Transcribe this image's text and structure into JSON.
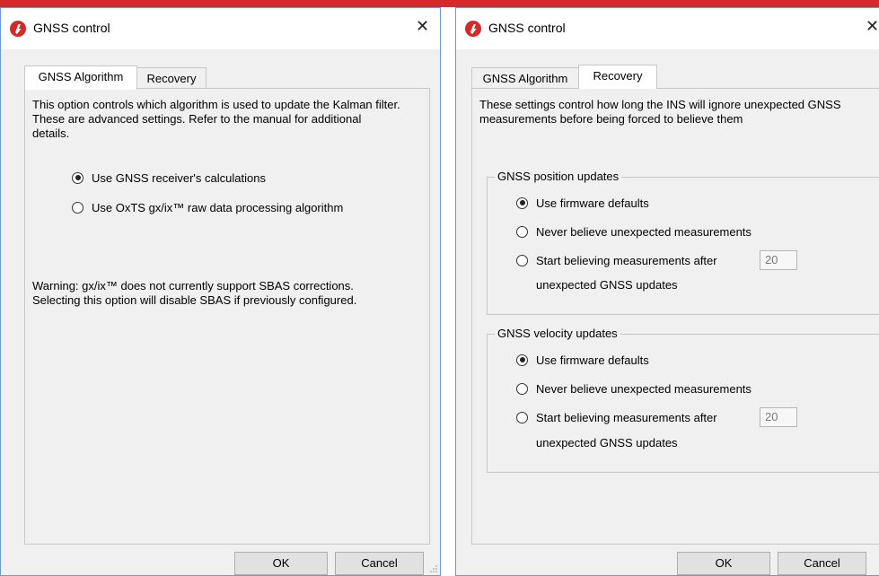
{
  "brand_color": "#d42a2a",
  "left_window": {
    "title": "GNSS control",
    "icon": "oxts-logo-icon",
    "close_label": "✕",
    "tabs": [
      {
        "label": "GNSS Algorithm",
        "active": true
      },
      {
        "label": "Recovery",
        "active": false
      }
    ],
    "description": "This option controls which algorithm is used to update the Kalman filter.  These are advanced settings.  Refer to the manual for additional details.",
    "options": [
      {
        "label": "Use GNSS receiver's calculations",
        "checked": true
      },
      {
        "label": "Use OxTS gx/ix™ raw data processing algorithm",
        "checked": false
      }
    ],
    "warning_line1": "Warning: gx/ix™ does not currently support SBAS corrections.",
    "warning_line2": "Selecting this option will disable SBAS if previously configured.",
    "ok_label": "OK",
    "cancel_label": "Cancel"
  },
  "right_window": {
    "title": "GNSS control",
    "icon": "oxts-logo-icon",
    "close_label": "✕",
    "tabs": [
      {
        "label": "GNSS Algorithm",
        "active": false
      },
      {
        "label": "Recovery",
        "active": true
      }
    ],
    "description": "These settings control how long the INS will ignore unexpected GNSS measurements before being forced to believe them",
    "position_group": {
      "title": "GNSS position updates",
      "options": [
        {
          "label": "Use firmware defaults",
          "checked": true
        },
        {
          "label": "Never believe unexpected measurements",
          "checked": false
        },
        {
          "label": "Start believing measurements after",
          "checked": false
        }
      ],
      "count_value": "20",
      "suffix": "unexpected GNSS updates"
    },
    "velocity_group": {
      "title": "GNSS velocity updates",
      "options": [
        {
          "label": "Use firmware defaults",
          "checked": true
        },
        {
          "label": "Never believe unexpected measurements",
          "checked": false
        },
        {
          "label": "Start believing measurements after",
          "checked": false
        }
      ],
      "count_value": "20",
      "suffix": "unexpected GNSS updates"
    },
    "ok_label": "OK",
    "cancel_label": "Cancel"
  }
}
